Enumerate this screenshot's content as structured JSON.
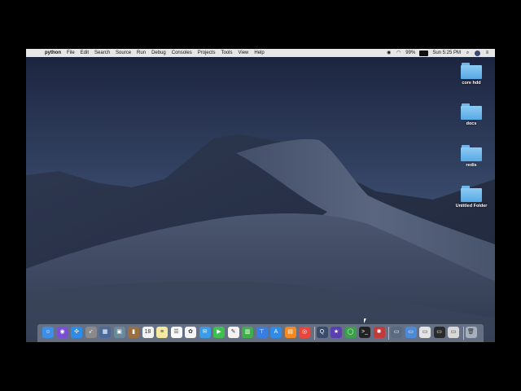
{
  "menubar": {
    "apple_glyph": "",
    "app_name": "python",
    "items": [
      "File",
      "Edit",
      "Search",
      "Source",
      "Run",
      "Debug",
      "Consoles",
      "Projects",
      "Tools",
      "View",
      "Help"
    ],
    "battery_text": "99%",
    "battery_level": 0.99,
    "clock": "Sun 5:25 PM",
    "search_glyph": "⌕",
    "siri_glyph": "≋",
    "wifi_glyph": "◠",
    "menu_glyph": "≡"
  },
  "desktop": {
    "items": [
      {
        "label": "core hdd"
      },
      {
        "label": "docs"
      },
      {
        "label": "redis"
      },
      {
        "label": "Untitled Folder"
      }
    ]
  },
  "dock": {
    "apps": [
      {
        "name": "finder-icon",
        "color": "#3d8ee6",
        "glyph": "☺"
      },
      {
        "name": "siri-icon",
        "color": "#7a4fd6",
        "glyph": "◉"
      },
      {
        "name": "safari-icon",
        "color": "#2f8be8",
        "glyph": "✣"
      },
      {
        "name": "launchpad-icon",
        "color": "#8a8a8a",
        "glyph": "➶"
      },
      {
        "name": "photo-booth-icon",
        "color": "#4a6a9a",
        "glyph": "▦"
      },
      {
        "name": "preview-icon",
        "color": "#6a8a9a",
        "glyph": "▣"
      },
      {
        "name": "notes-book-icon",
        "color": "#9a7040",
        "glyph": "▮"
      },
      {
        "name": "calendar-icon",
        "color": "#f2f2f2",
        "glyph": "18"
      },
      {
        "name": "notes-icon",
        "color": "#f4e9a0",
        "glyph": "≡"
      },
      {
        "name": "reminders-icon",
        "color": "#fafafa",
        "glyph": "☰"
      },
      {
        "name": "photos-icon",
        "color": "#f5f5f5",
        "glyph": "✿"
      },
      {
        "name": "messages-icon",
        "color": "#3a9be8",
        "glyph": "✉"
      },
      {
        "name": "facetime-icon",
        "color": "#3fbf4f",
        "glyph": "▶"
      },
      {
        "name": "pages-icon",
        "color": "#f2f2f2",
        "glyph": "✎"
      },
      {
        "name": "numbers-icon",
        "color": "#3fae4a",
        "glyph": "▥"
      },
      {
        "name": "keynote-icon",
        "color": "#3a7de0",
        "glyph": "⊤"
      },
      {
        "name": "app-store-icon",
        "color": "#2f8be8",
        "glyph": "A"
      },
      {
        "name": "books-icon",
        "color": "#f28a1f",
        "glyph": "▤"
      },
      {
        "name": "chrome-icon",
        "color": "#e8453c",
        "glyph": "◎"
      },
      {
        "name": "quicktime-icon",
        "color": "#3a4a6a",
        "glyph": "Q"
      },
      {
        "name": "imovie-icon",
        "color": "#5a3fb0",
        "glyph": "★"
      },
      {
        "name": "spyder-icon",
        "color": "#3aa04a",
        "glyph": "◯"
      },
      {
        "name": "terminal-icon",
        "color": "#222222",
        "glyph": ">_"
      },
      {
        "name": "network-utility-icon",
        "color": "#c23a3a",
        "glyph": "✺"
      },
      {
        "name": "window-a-icon",
        "color": "#5a6a80",
        "glyph": "▭"
      },
      {
        "name": "window-b-icon",
        "color": "#4a8ad8",
        "glyph": "▭"
      },
      {
        "name": "window-c-icon",
        "color": "#e4e4e4",
        "glyph": "▭"
      },
      {
        "name": "window-d-icon",
        "color": "#2a2a2a",
        "glyph": "▭"
      },
      {
        "name": "window-e-icon",
        "color": "#d8d8d8",
        "glyph": "▭"
      },
      {
        "name": "trash-icon",
        "color": "#a6b0bc",
        "glyph": "🗑"
      }
    ]
  }
}
